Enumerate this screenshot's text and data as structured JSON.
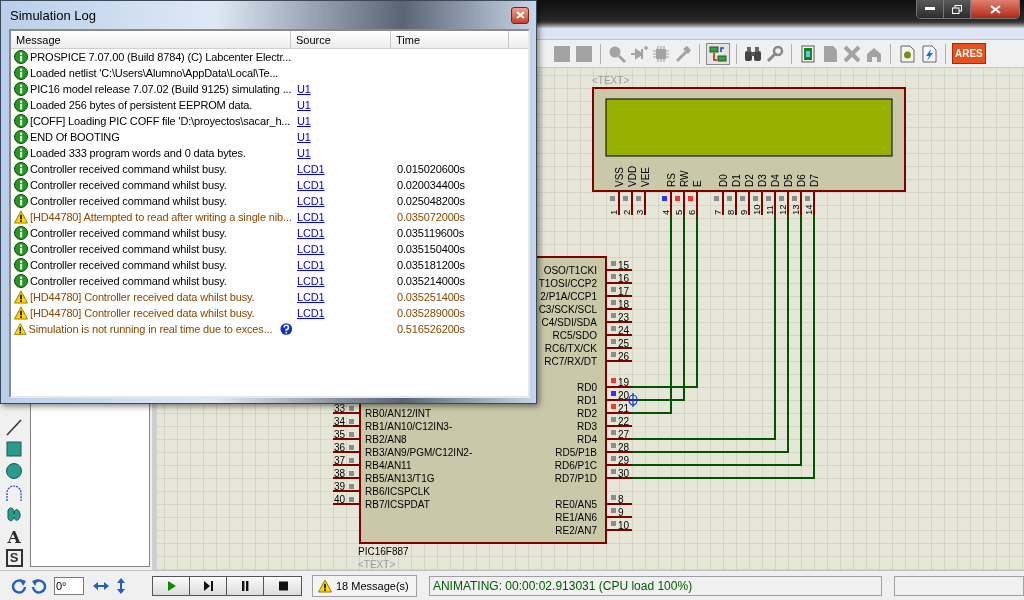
{
  "log_window": {
    "title": "Simulation Log",
    "columns": [
      "Message",
      "Source",
      "Time"
    ],
    "rows": [
      {
        "kind": "info",
        "message": "PROSPICE 7.07.00 (Build 8784) (C) Labcenter Electr..."
      },
      {
        "kind": "info",
        "message": "Loaded netlist 'C:\\Users\\Alumno\\AppData\\Local\\Te..."
      },
      {
        "kind": "info",
        "message": "PIC16 model release 7.07.02 (Build 9125) simulating ...",
        "source": "U1"
      },
      {
        "kind": "info",
        "message": "Loaded 256 bytes of persistent EEPROM data.",
        "source": "U1"
      },
      {
        "kind": "info",
        "message": "[COFF] Loading PIC COFF file 'D:\\proyectos\\sacar_h...",
        "source": "U1"
      },
      {
        "kind": "info",
        "message": "END Of BOOTING",
        "source": "U1"
      },
      {
        "kind": "info",
        "message": "Loaded 333 program words and 0 data bytes.",
        "source": "U1"
      },
      {
        "kind": "info",
        "message": "Controller received command whilst busy.",
        "source": "LCD1",
        "time": "0.015020600s"
      },
      {
        "kind": "info",
        "message": "Controller received command whilst busy.",
        "source": "LCD1",
        "time": "0.020034400s"
      },
      {
        "kind": "info",
        "message": "Controller received command whilst busy.",
        "source": "LCD1",
        "time": "0.025048200s"
      },
      {
        "kind": "warning",
        "message": "[HD44780] Attempted to read after writing a single nib...",
        "source": "LCD1",
        "time": "0.035072000s"
      },
      {
        "kind": "info",
        "message": "Controller received command whilst busy.",
        "source": "LCD1",
        "time": "0.035119600s"
      },
      {
        "kind": "info",
        "message": "Controller received command whilst busy.",
        "source": "LCD1",
        "time": "0.035150400s"
      },
      {
        "kind": "info",
        "message": "Controller received command whilst busy.",
        "source": "LCD1",
        "time": "0.035181200s"
      },
      {
        "kind": "info",
        "message": "Controller received command whilst busy.",
        "source": "LCD1",
        "time": "0.035214000s"
      },
      {
        "kind": "warning",
        "message": "[HD44780] Controller received data whilst busy.",
        "source": "LCD1",
        "time": "0.035251400s"
      },
      {
        "kind": "warning",
        "message": "[HD44780] Controller received data whilst busy.",
        "source": "LCD1",
        "time": "0.035289000s"
      },
      {
        "kind": "warning",
        "message": "Simulation is not running in real time due to exces...",
        "help": true,
        "time": "0.516526200s"
      }
    ]
  },
  "toolbar": {
    "toggle_pressed": true,
    "logo": "ARES"
  },
  "tools": [
    {
      "kind": "line"
    },
    {
      "kind": "box"
    },
    {
      "kind": "circle"
    },
    {
      "kind": "arc"
    },
    {
      "kind": "path"
    },
    {
      "kind": "text",
      "glyph": "A"
    },
    {
      "kind": "symbol",
      "glyph": "S"
    }
  ],
  "schematic": {
    "lcd": {
      "ref_text": "<TEXT>",
      "pins": [
        {
          "label": "VSS",
          "number": "1",
          "color": "#8c8c8c"
        },
        {
          "label": "VDD",
          "number": "2",
          "color": "#8c8c8c"
        },
        {
          "label": "VEE",
          "number": "3",
          "color": "#8c8c8c"
        },
        {
          "label": "RS",
          "number": "4",
          "color": "#3030ff"
        },
        {
          "label": "RW",
          "number": "5",
          "color": "#ff3030"
        },
        {
          "label": "E",
          "number": "6",
          "color": "#ff3030"
        },
        {
          "label": "D0",
          "number": "7",
          "color": "#8c8c8c"
        },
        {
          "label": "D1",
          "number": "8",
          "color": "#8c8c8c"
        },
        {
          "label": "D2",
          "number": "9",
          "color": "#8c8c8c"
        },
        {
          "label": "D3",
          "number": "10",
          "color": "#8c8c8c"
        },
        {
          "label": "D4",
          "number": "11",
          "color": "#8c8c8c"
        },
        {
          "label": "D5",
          "number": "12",
          "color": "#8c8c8c"
        },
        {
          "label": "D6",
          "number": "13",
          "color": "#8c8c8c"
        },
        {
          "label": "D7",
          "number": "14",
          "color": "#8c8c8c"
        }
      ]
    },
    "mcu": {
      "part": "PIC16F887",
      "ref_text": "<TEXT>",
      "left_pins": [
        {
          "number": "33",
          "label": "RB0/AN12/INT",
          "color": "#8c8c8c"
        },
        {
          "number": "34",
          "label": "RB1/AN10/C12IN3-",
          "color": "#8c8c8c"
        },
        {
          "number": "35",
          "label": "RB2/AN8",
          "color": "#8c8c8c"
        },
        {
          "number": "36",
          "label": "RB3/AN9/PGM/C12IN2-",
          "color": "#8c8c8c"
        },
        {
          "number": "37",
          "label": "RB4/AN11",
          "color": "#8c8c8c"
        },
        {
          "number": "38",
          "label": "RB5/AN13/T1G",
          "color": "#8c8c8c"
        },
        {
          "number": "39",
          "label": "RB6/ICSPCLK",
          "color": "#8c8c8c"
        },
        {
          "number": "40",
          "label": "RB7/ICSPDAT",
          "color": "#8c8c8c"
        }
      ],
      "right_pins": [
        {
          "number": "15",
          "label": "OSO/T1CKI",
          "color": "#8c8c8c"
        },
        {
          "number": "16",
          "label": "T1OSI/CCP2",
          "color": "#8c8c8c"
        },
        {
          "number": "17",
          "label": "2/P1A/CCP1",
          "color": "#8c8c8c"
        },
        {
          "number": "18",
          "label": "C3/SCK/SCL",
          "color": "#8c8c8c"
        },
        {
          "number": "23",
          "label": "C4/SDI/SDA",
          "color": "#8c8c8c"
        },
        {
          "number": "24",
          "label": "RC5/SDO",
          "color": "#8c8c8c"
        },
        {
          "number": "25",
          "label": "RC6/TX/CK",
          "color": "#8c8c8c"
        },
        {
          "number": "26",
          "label": "RC7/RX/DT",
          "color": "#8c8c8c"
        },
        {
          "number": "19",
          "label": "RD0",
          "color": "#ff3030"
        },
        {
          "number": "20",
          "label": "RD1",
          "color": "#3030ff"
        },
        {
          "number": "21",
          "label": "RD2",
          "color": "#ff3030"
        },
        {
          "number": "22",
          "label": "RD3",
          "color": "#8c8c8c"
        },
        {
          "number": "27",
          "label": "RD4",
          "color": "#8c8c8c"
        },
        {
          "number": "28",
          "label": "RD5/P1B",
          "color": "#8c8c8c"
        },
        {
          "number": "29",
          "label": "RD6/P1C",
          "color": "#8c8c8c"
        },
        {
          "number": "30",
          "label": "RD7/P1D",
          "color": "#8c8c8c"
        },
        {
          "number": "8",
          "label": "RE0/AN5",
          "color": "#8c8c8c"
        },
        {
          "number": "9",
          "label": "RE1/AN6",
          "color": "#8c8c8c"
        },
        {
          "number": "10",
          "label": "RE2/AN7",
          "color": "#8c8c8c"
        }
      ]
    }
  },
  "controls": {
    "rotation": "0°",
    "transport": [
      {
        "kind": "play"
      },
      {
        "kind": "step"
      },
      {
        "kind": "pause"
      },
      {
        "kind": "stop"
      }
    ],
    "messages": "18 Message(s)",
    "status": "ANIMATING: 00:00:02.913031 (CPU load 100%)"
  }
}
